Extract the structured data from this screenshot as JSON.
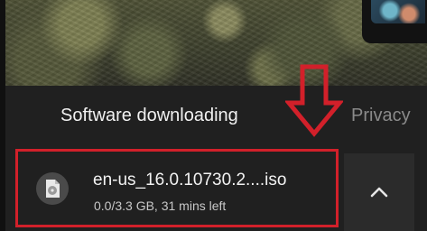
{
  "downloads_bar": {
    "title": "Software downloading",
    "privacy_label": "Privacy"
  },
  "download_item": {
    "file_name": "en-us_16.0.10730.2....iso",
    "status": "0.0/3.3 GB, 31 mins left",
    "icon": "disc-file-icon",
    "highlight_color": "#d2202a"
  },
  "annotation": {
    "arrow_icon": "down-arrow-annotation",
    "color": "#d2202a"
  },
  "expand_button": {
    "icon": "chevron-up-icon"
  },
  "theme": {
    "bar_background": "#202020",
    "text_primary": "#f1f1f1",
    "text_secondary": "#c8c8c8",
    "text_muted": "#8a8a8a"
  }
}
